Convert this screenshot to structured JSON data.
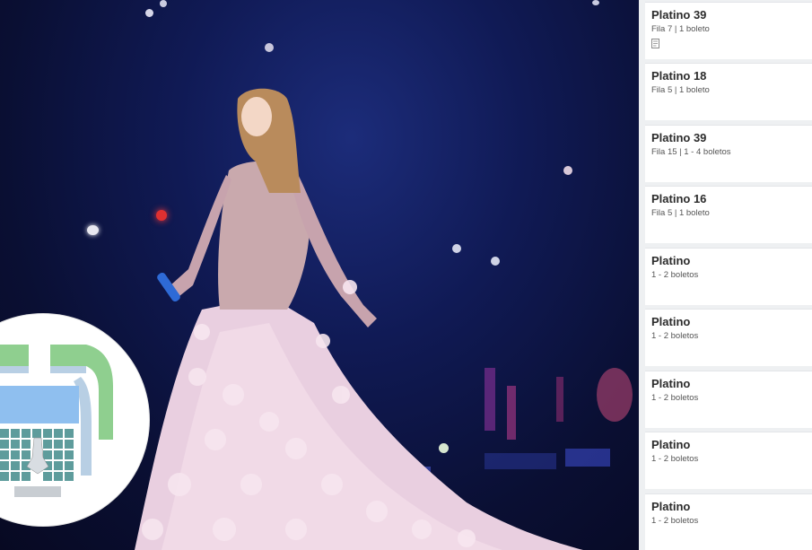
{
  "colors": {
    "stage_bg": "#0b0d2a",
    "panel_bg": "#eef0f2",
    "card_bg": "#ffffff",
    "title_text": "#2b2b2b"
  },
  "seat_map": {
    "icon": "venue-map-icon"
  },
  "listings": [
    {
      "title": "Platino 39",
      "detail": "Fila 7 | 1 boleto",
      "icon": "note-icon"
    },
    {
      "title": "Platino 18",
      "detail": "Fila 5 | 1 boleto"
    },
    {
      "title": "Platino 39",
      "detail": "Fila 15 | 1 - 4 boletos"
    },
    {
      "title": "Platino 16",
      "detail": "Fila 5 | 1 boleto"
    },
    {
      "title": "Platino",
      "detail": "1 - 2 boletos"
    },
    {
      "title": "Platino",
      "detail": "1 - 2 boletos"
    },
    {
      "title": "Platino",
      "detail": "1 - 2 boletos"
    },
    {
      "title": "Platino",
      "detail": "1 - 2 boletos"
    },
    {
      "title": "Platino",
      "detail": "1 - 2 boletos"
    }
  ]
}
